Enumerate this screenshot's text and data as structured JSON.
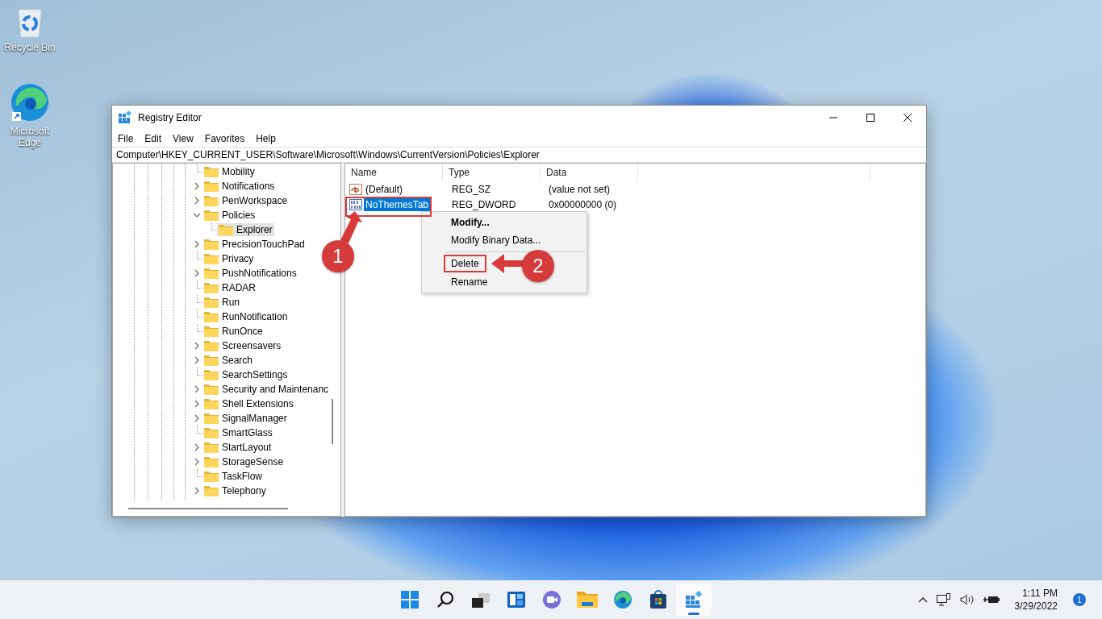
{
  "desktop_icons": [
    {
      "label": "Recycle Bin",
      "kind": "recycle"
    },
    {
      "label": "Microsoft Edge",
      "kind": "edge"
    }
  ],
  "window": {
    "title": "Registry Editor",
    "menu": [
      "File",
      "Edit",
      "View",
      "Favorites",
      "Help"
    ],
    "address": "Computer\\HKEY_CURRENT_USER\\Software\\Microsoft\\Windows\\CurrentVersion\\Policies\\Explorer",
    "tree": {
      "items": [
        {
          "label": "Mobility",
          "has_children": false,
          "selected": false
        },
        {
          "label": "Notifications",
          "has_children": true,
          "selected": false
        },
        {
          "label": "PenWorkspace",
          "has_children": true,
          "selected": false
        },
        {
          "label": "Policies",
          "has_children": true,
          "expanded": true,
          "selected": false,
          "children": [
            {
              "label": "Explorer",
              "has_children": false,
              "selected": true
            }
          ]
        },
        {
          "label": "PrecisionTouchPad",
          "has_children": true,
          "selected": false
        },
        {
          "label": "Privacy",
          "has_children": false,
          "selected": false
        },
        {
          "label": "PushNotifications",
          "has_children": true,
          "selected": false
        },
        {
          "label": "RADAR",
          "has_children": false,
          "selected": false
        },
        {
          "label": "Run",
          "has_children": false,
          "selected": false
        },
        {
          "label": "RunNotification",
          "has_children": false,
          "selected": false
        },
        {
          "label": "RunOnce",
          "has_children": false,
          "selected": false
        },
        {
          "label": "Screensavers",
          "has_children": true,
          "selected": false
        },
        {
          "label": "Search",
          "has_children": true,
          "selected": false
        },
        {
          "label": "SearchSettings",
          "has_children": false,
          "selected": false
        },
        {
          "label": "Security and Maintenanc",
          "has_children": true,
          "selected": false
        },
        {
          "label": "Shell Extensions",
          "has_children": true,
          "selected": false
        },
        {
          "label": "SignalManager",
          "has_children": true,
          "selected": false
        },
        {
          "label": "SmartGlass",
          "has_children": false,
          "selected": false
        },
        {
          "label": "StartLayout",
          "has_children": true,
          "selected": false
        },
        {
          "label": "StorageSense",
          "has_children": true,
          "selected": false
        },
        {
          "label": "TaskFlow",
          "has_children": false,
          "selected": false
        },
        {
          "label": "Telephony",
          "has_children": true,
          "selected": false
        }
      ]
    },
    "values": {
      "columns": [
        "Name",
        "Type",
        "Data"
      ],
      "rows": [
        {
          "name": "(Default)",
          "type": "REG_SZ",
          "data": "(value not set)",
          "kind": "string",
          "selected": false
        },
        {
          "name": "NoThemesTab",
          "type": "REG_DWORD",
          "data": "0x00000000 (0)",
          "kind": "binary",
          "selected": true
        }
      ]
    },
    "context_menu": [
      {
        "kind": "default",
        "label": "Modify...",
        "highlighted": false
      },
      {
        "kind": "item",
        "label": "Modify Binary Data...",
        "highlighted": false
      },
      {
        "kind": "separator"
      },
      {
        "kind": "item",
        "label": "Delete",
        "highlighted": true
      },
      {
        "kind": "item",
        "label": "Rename",
        "highlighted": false
      }
    ]
  },
  "annotations": [
    {
      "number": "1",
      "kind": "arrow-up"
    },
    {
      "number": "2",
      "kind": "arrow-left"
    }
  ],
  "taskbar": {
    "apps": [
      {
        "kind": "start",
        "active": false
      },
      {
        "kind": "search",
        "active": false
      },
      {
        "kind": "taskview",
        "active": false
      },
      {
        "kind": "widgets",
        "active": false
      },
      {
        "kind": "chat",
        "active": false
      },
      {
        "kind": "explorer",
        "active": false
      },
      {
        "kind": "edge",
        "active": false
      },
      {
        "kind": "store",
        "active": false
      },
      {
        "kind": "regedit",
        "active": true
      }
    ],
    "time": "1:11 PM",
    "date": "3/29/2022",
    "notifications": "1"
  }
}
